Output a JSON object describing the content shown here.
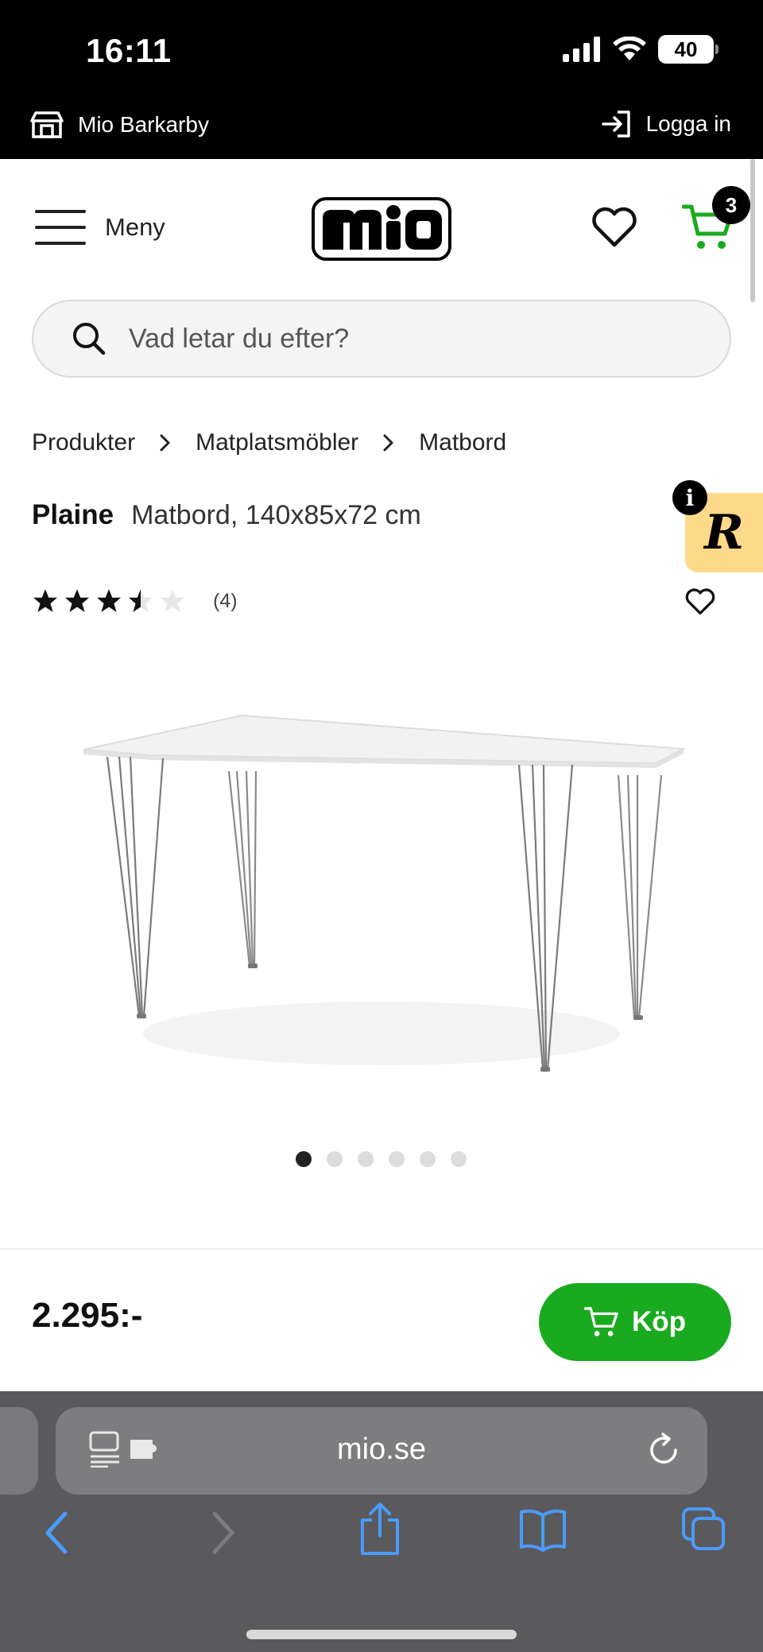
{
  "status_bar": {
    "time": "16:11",
    "battery": "40"
  },
  "store_bar": {
    "store_name": "Mio Barkarby",
    "login_label": "Logga in"
  },
  "header": {
    "menu_label": "Meny",
    "logo_text": "mio",
    "cart_count": "3"
  },
  "search": {
    "placeholder": "Vad letar du efter?"
  },
  "breadcrumb": [
    "Produkter",
    "Matplatsmöbler",
    "Matbord"
  ],
  "product": {
    "name": "Plaine",
    "description": "Matbord, 140x85x72 cm",
    "rating": 3.5,
    "rating_max": 5,
    "review_count": "(4)",
    "image_count": 6,
    "active_image": 1
  },
  "widget": {
    "letter": "R",
    "info": "i"
  },
  "buy_bar": {
    "price": "2.295:-",
    "buy_label": "Köp"
  },
  "browser": {
    "url": "mio.se"
  },
  "colors": {
    "accent_green": "#1aaa1f",
    "widget_yellow": "#ffd98a",
    "bar_black": "#000000"
  }
}
